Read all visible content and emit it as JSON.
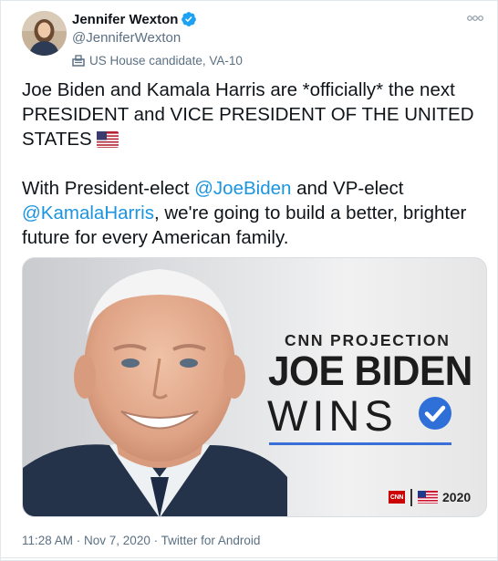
{
  "author": {
    "display_name": "Jennifer Wexton",
    "handle": "@JenniferWexton",
    "label": "US House candidate, VA-10"
  },
  "icons": {
    "verified": "verified-badge-icon",
    "label": "ballot-box-icon",
    "more": "more-options-icon",
    "flag": "us-flag-emoji"
  },
  "tweet": {
    "line1": "Joe Biden and Kamala Harris are *officially* the next PRESIDENT and VICE PRESIDENT OF THE UNITED STATES",
    "line2_prefix": "With President-elect ",
    "mention1": "@JoeBiden",
    "line2_middle": " and VP-elect ",
    "mention2": "@KamalaHarris",
    "line2_suffix": ", we're going to build a better, brighter future for every American family."
  },
  "media": {
    "kicker": "CNN PROJECTION",
    "headline": "JOE BIDEN",
    "subhead": "WINS",
    "network_logo": "CNN",
    "year": "2020"
  },
  "meta": {
    "text": "11:28 AM · Nov 7, 2020 · Twitter for Android"
  },
  "colors": {
    "text": "#0f1419",
    "secondary": "#5b7083",
    "link": "#1b95e0",
    "verified": "#1da1f2",
    "accent_blue": "#3a6fd8",
    "cnn_red": "#cc0000"
  }
}
